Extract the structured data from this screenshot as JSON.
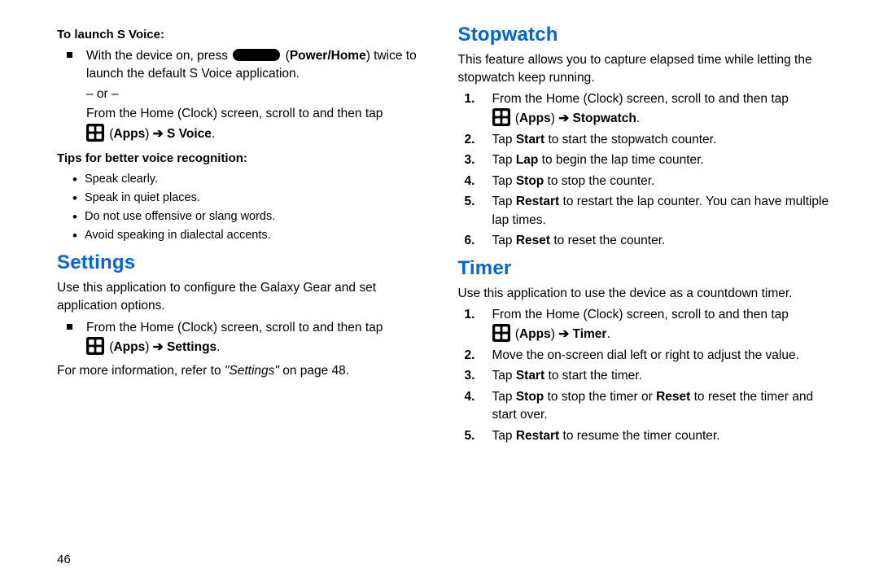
{
  "left": {
    "svoice": {
      "launch_head": "To launch S Voice:",
      "bullet_a_pre": "With the device on, press ",
      "bullet_a_btn": "Power/Home",
      "bullet_a_post": ") twice to launch the default S Voice application.",
      "or": "– or –",
      "bullet_b": "From the Home (Clock) screen, scroll to and then tap ",
      "apps_label": "Apps",
      "svoice_label": "S Voice",
      "tips_head": "Tips for better voice recognition:",
      "tips": [
        "Speak clearly.",
        "Speak in quiet places.",
        "Do not use offensive or slang words.",
        "Avoid speaking in dialectal accents."
      ]
    },
    "settings": {
      "title": "Settings",
      "intro": "Use this application to configure the Galaxy Gear and set application options.",
      "bullet": "From the Home (Clock) screen, scroll to and then tap ",
      "apps_label": "Apps",
      "settings_label": "Settings",
      "more_pre": "For more information, refer to ",
      "more_ref": "\"Settings\"",
      "more_post": " on page 48."
    }
  },
  "right": {
    "stopwatch": {
      "title": "Stopwatch",
      "intro": "This feature allows you to capture elapsed time while letting the stopwatch keep running.",
      "n1": "From the Home (Clock) screen, scroll to and then tap ",
      "apps_label": "Apps",
      "sw_label": "Stopwatch",
      "n2_a": "Tap ",
      "n2_bold": "Start",
      "n2_b": " to start the stopwatch counter.",
      "n3_a": "Tap ",
      "n3_bold": "Lap",
      "n3_b": " to begin the lap time counter.",
      "n4_a": "Tap ",
      "n4_bold": "Stop",
      "n4_b": " to stop the counter.",
      "n5_a": "Tap ",
      "n5_bold": "Restart",
      "n5_b": " to restart the lap counter. You can have multiple lap times.",
      "n6_a": "Tap ",
      "n6_bold": "Reset",
      "n6_b": " to reset the counter."
    },
    "timer": {
      "title": "Timer",
      "intro": "Use this application to use the device as a countdown timer.",
      "n1": "From the Home (Clock) screen, scroll to and then tap ",
      "apps_label": "Apps",
      "t_label": "Timer",
      "n2": "Move the on-screen dial left or right to adjust the value.",
      "n3_a": "Tap ",
      "n3_bold": "Start",
      "n3_b": " to start the timer.",
      "n4_a": "Tap ",
      "n4_bold1": "Stop",
      "n4_mid": " to stop the timer or ",
      "n4_bold2": "Reset",
      "n4_b": " to reset the timer and start over.",
      "n5_a": "Tap ",
      "n5_bold": "Restart",
      "n5_b": " to resume the timer counter."
    }
  },
  "page_number": "46"
}
